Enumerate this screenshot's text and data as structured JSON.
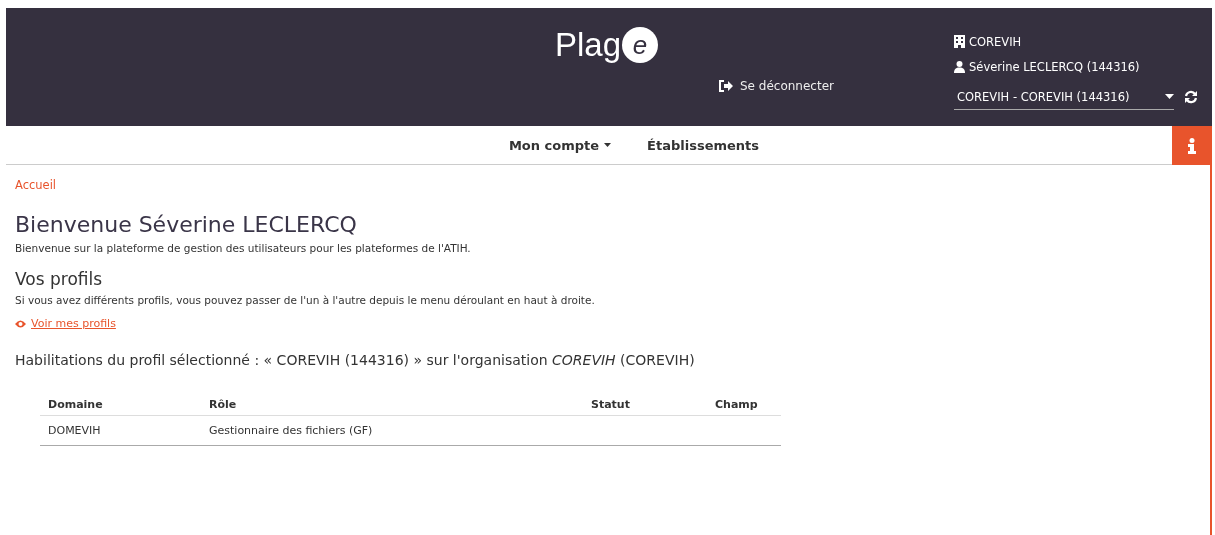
{
  "header": {
    "logo": {
      "text": "Plag",
      "badge": "e"
    },
    "logout": "Se déconnecter",
    "organisation": "COREVIH",
    "user": "Séverine LECLERCQ (144316)",
    "profile_select": {
      "value": "COREVIH - COREVIH (144316)"
    }
  },
  "nav": {
    "items": [
      {
        "label": "Mon compte",
        "dropdown": true
      },
      {
        "label": "Établissements",
        "dropdown": false
      }
    ]
  },
  "breadcrumb": "Accueil",
  "title": "Bienvenue Séverine LECLERCQ",
  "intro": "Bienvenue sur la plateforme de gestion des utilisateurs pour les plateformes de l'ATIH.",
  "profiles": {
    "heading": "Vos profils",
    "text": "Si vous avez différents profils, vous pouvez passer de l'un à l'autre depuis le menu déroulant en haut à droite.",
    "link": "Voir mes profils"
  },
  "habilitations": {
    "heading": "Habilitations du profil sélectionné : « COREVIH (144316) » sur l'organisation *COREVIH* (COREVIH)",
    "table": {
      "columns": [
        "Domaine",
        "Rôle",
        "Statut",
        "Champ"
      ],
      "rows": [
        [
          "DOMEVIH",
          "Gestionnaire des fichiers (GF)",
          "",
          ""
        ]
      ]
    }
  }
}
